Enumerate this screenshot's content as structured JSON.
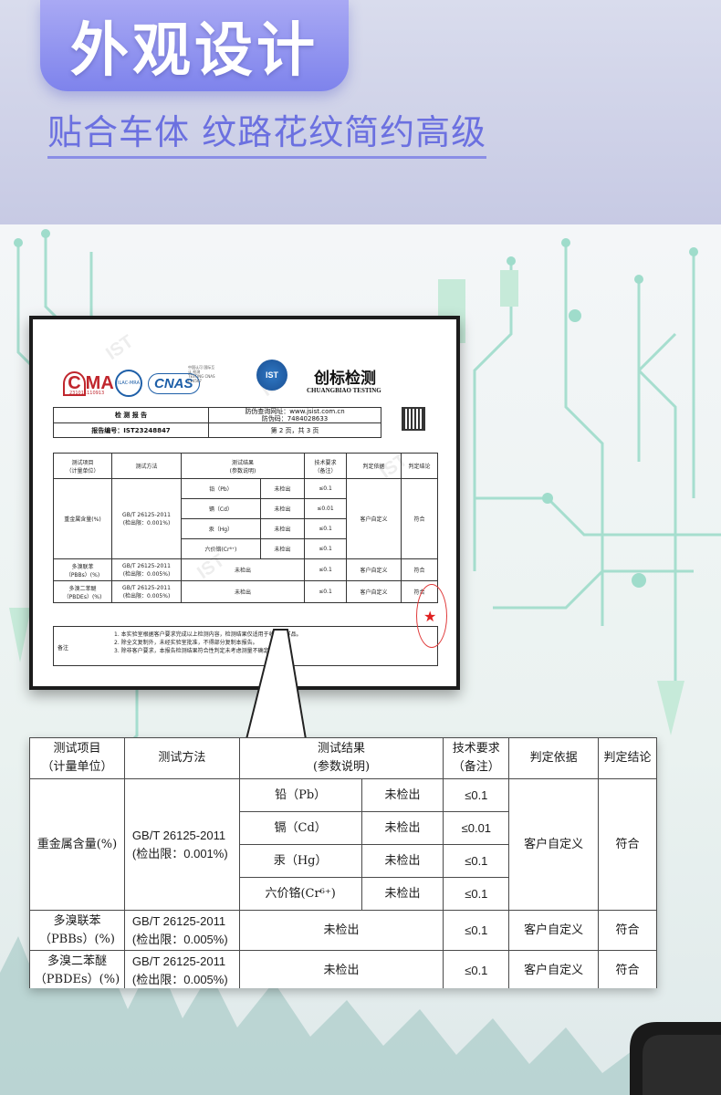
{
  "header": {
    "title": "外观设计",
    "subtitle": "贴合车体 纹路花纹简约高级"
  },
  "report": {
    "cma_label": "MA",
    "cma_number": "231011110913",
    "ilac_label": "ILAC-MRA",
    "cnas_label": "CNAS",
    "cnas_note": "中国认可 国际互认 检测 TESTING CNAS L14567",
    "brand_logo": "IST",
    "brand_cn": "创标检测",
    "brand_en": "CHUANGBIAO TESTING",
    "report_title": "检 测 报 告",
    "report_number_label": "报告编号：IST23248847",
    "verify_site": "防伪查询网址：www.jsist.com.cn",
    "verify_code": "防伪码：7484028633",
    "page_info": "第 2 页，共 3 页",
    "remark_label": "备注",
    "remarks": [
      "1.  本实验室根据客户要求完成以上检测内容，检测结果仅适用于收到的样品。",
      "2.  除全文复制外，未经实验室批准，不得部分复制本报告。",
      "3.  除非客户要求，本报告检测结果符合性判定未考虑测量不确定度。"
    ],
    "watermark": "IST"
  },
  "table": {
    "headers": {
      "item": "测试项目\n（计量单位）",
      "method": "测试方法",
      "result": "测试结果\n(参数说明)",
      "requirement": "技术要求\n（备注）",
      "basis": "判定依据",
      "conclusion": "判定结论"
    },
    "heavy_metal": {
      "item": "重金属含量(%)",
      "method": "GB/T 26125-2011\n(检出限：0.001%)",
      "basis": "客户自定义",
      "conclusion": "符合",
      "rows": [
        {
          "element": "铅（Pb）",
          "result": "未检出",
          "requirement": "≤0.1"
        },
        {
          "element": "镉（Cd）",
          "result": "未检出",
          "requirement": "≤0.01"
        },
        {
          "element": "汞（Hg）",
          "result": "未检出",
          "requirement": "≤0.1"
        },
        {
          "element": "六价铬(Cr⁶⁺)",
          "result": "未检出",
          "requirement": "≤0.1"
        }
      ]
    },
    "pbbs": {
      "item": "多溴联苯\n（PBBs）(%)",
      "method": "GB/T 26125-2011\n(检出限：0.005%)",
      "result": "未检出",
      "requirement": "≤0.1",
      "basis": "客户自定义",
      "conclusion": "符合"
    },
    "pbdes": {
      "item": "多溴二苯醚\n（PBDEs）(%)",
      "method": "GB/T 26125-2011\n(检出限：0.005%)",
      "result": "未检出",
      "requirement": "≤0.1",
      "basis": "客户自定义",
      "conclusion": "符合"
    }
  },
  "colors": {
    "accent": "#7e83ec",
    "circuit": "#8fd8c4",
    "stamp": "#e02020"
  }
}
